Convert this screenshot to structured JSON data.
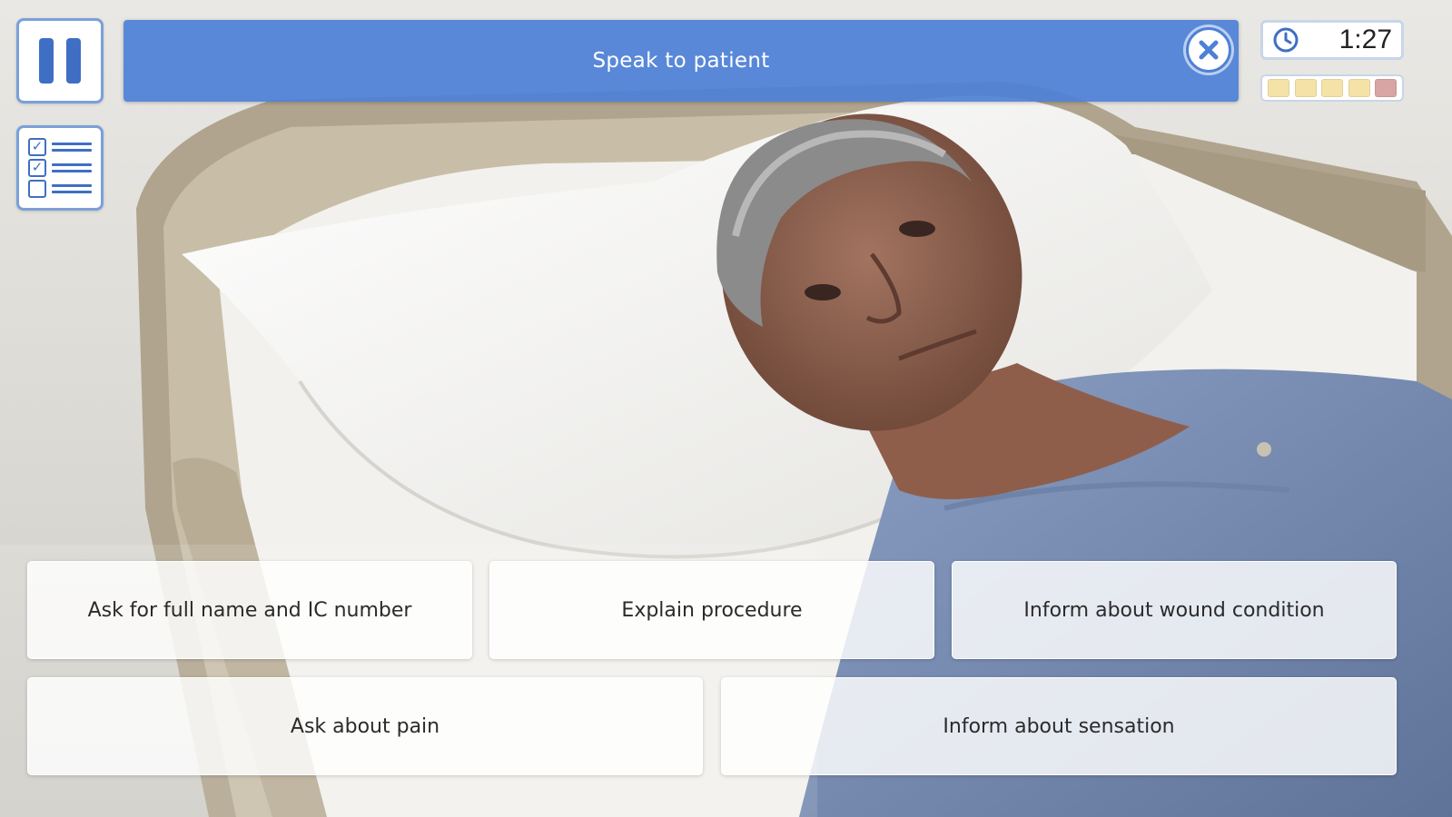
{
  "hud": {
    "prompt": "Speak to patient",
    "timer": "1:27",
    "score_slots": [
      "#f5e2a6",
      "#f5e2a6",
      "#f5e2a6",
      "#f5e2a6",
      "#d9a4a4"
    ]
  },
  "icons": {
    "pause": "pause-icon",
    "checklist": "checklist-icon",
    "close": "close-icon",
    "clock": "clock-icon"
  },
  "options": [
    "Ask for full name and IC number",
    "Explain procedure",
    "Inform about wound condition",
    "Ask about pain",
    "Inform about sensation"
  ],
  "colors": {
    "accent": "#4d80d7",
    "accent_dark": "#3f6fc4"
  }
}
